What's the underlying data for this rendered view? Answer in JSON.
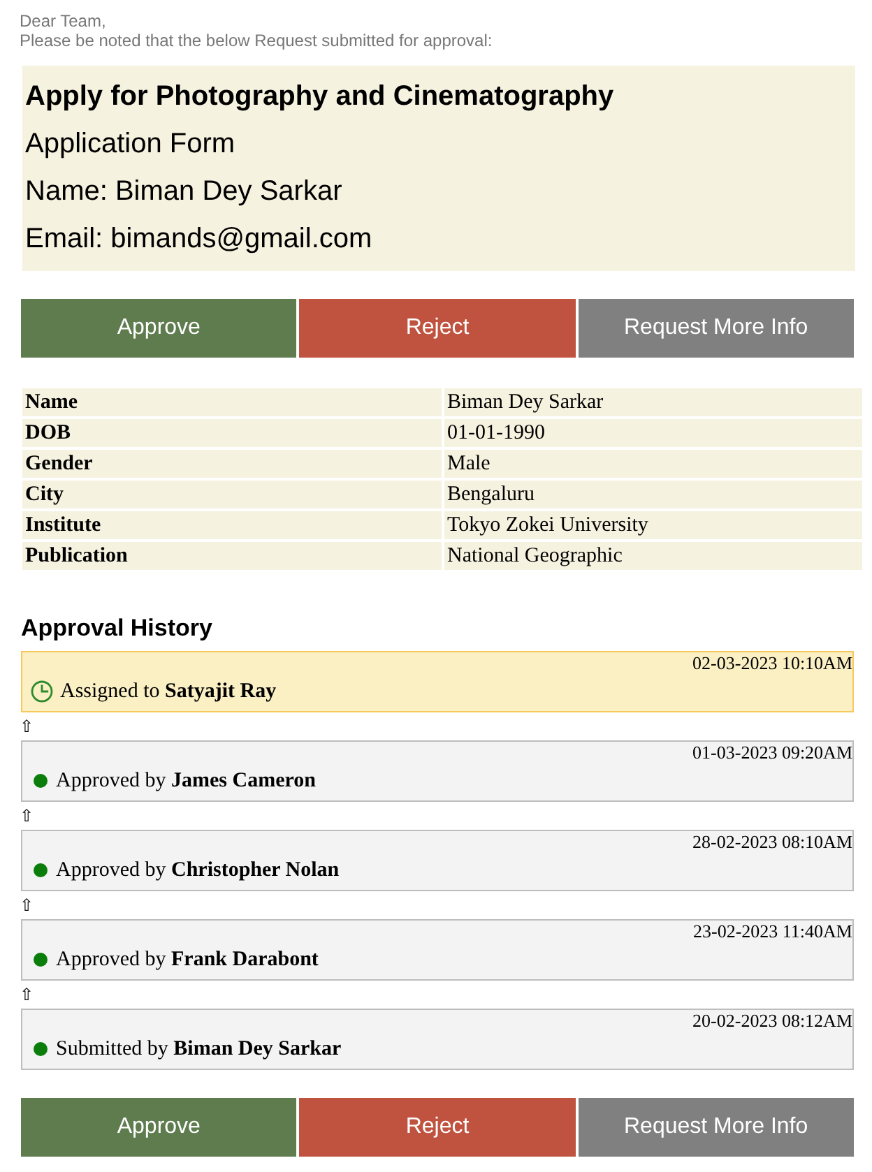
{
  "greeting": {
    "salutation": "Dear Team,",
    "message": "Please be noted that the below Request submitted for approval:"
  },
  "summary": {
    "title": "Apply for Photography and Cinematography",
    "subtitle": "Application Form",
    "name_line": "Name: Biman Dey Sarkar",
    "email_line": "Email: bimands@gmail.com"
  },
  "actions_top": [
    {
      "label": "Approve",
      "kind": "approve"
    },
    {
      "label": "Reject",
      "kind": "reject"
    },
    {
      "label": "Request More Info",
      "kind": "info"
    }
  ],
  "details": [
    {
      "label": "Name",
      "value": "Biman Dey Sarkar"
    },
    {
      "label": "DOB",
      "value": "01-01-1990"
    },
    {
      "label": "Gender",
      "value": "Male"
    },
    {
      "label": "City",
      "value": "Bengaluru"
    },
    {
      "label": "Institute",
      "value": "Tokyo Zokei University"
    },
    {
      "label": "Publication",
      "value": "National Geographic"
    }
  ],
  "history": {
    "heading": "Approval History",
    "items": [
      {
        "kind": "current",
        "time": "02-03-2023 10:10AM",
        "text": "Assigned to **Satyajit Ray**",
        "arrow": "⇧"
      },
      {
        "kind": "done",
        "time": "01-03-2023 09:20AM",
        "text": "Approved by **James Cameron**",
        "arrow": "⇧"
      },
      {
        "kind": "done",
        "time": "28-02-2023 08:10AM",
        "text": "Approved by **Christopher Nolan**",
        "arrow": "⇧"
      },
      {
        "kind": "done",
        "time": "23-02-2023 11:40AM",
        "text": "Approved by **Frank Darabont**",
        "arrow": "⇧"
      },
      {
        "kind": "done",
        "time": "20-02-2023 08:12AM",
        "text": "Submitted by **Biman Dey Sarkar**"
      }
    ]
  },
  "actions_bottom": [
    {
      "label": "Approve",
      "kind": "approve"
    },
    {
      "label": "Reject",
      "kind": "reject"
    },
    {
      "label": "Request More Info",
      "kind": "info"
    }
  ]
}
